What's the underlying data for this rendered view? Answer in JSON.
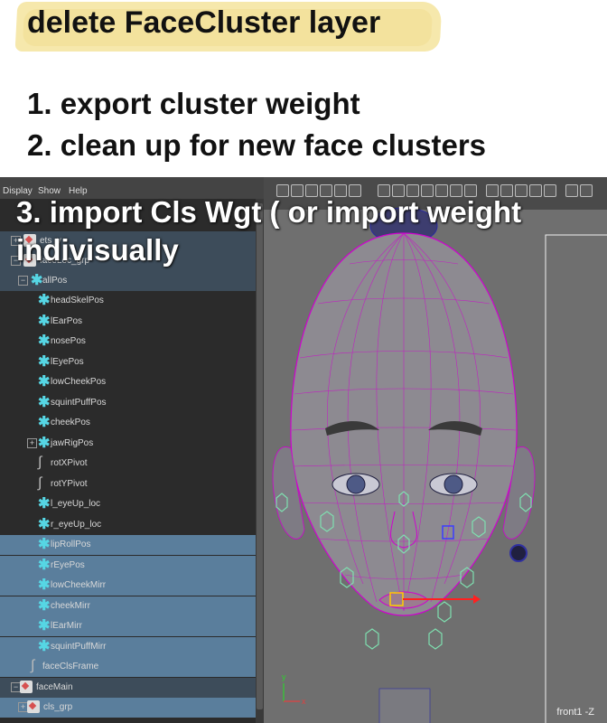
{
  "instructions": {
    "title": "delete FaceCluster layer",
    "step1": "1. export cluster weight",
    "step2": "2. clean up for new face clusters",
    "step3_line1": "3. import Cls Wgt ( or import weight",
    "step3_line2": "indivisually"
  },
  "menubar": {
    "display": "Display",
    "show": "Show",
    "help": "Help"
  },
  "outliner": {
    "rows": [
      {
        "label": "ets_v",
        "icon": "node-icon"
      },
      {
        "label": "faceLoc_grp",
        "icon": "node-icon"
      },
      {
        "label": "allPos",
        "icon": "locator-icon"
      },
      {
        "label": "headSkelPos",
        "icon": "locator-icon"
      },
      {
        "label": "lEarPos",
        "icon": "locator-icon"
      },
      {
        "label": "nosePos",
        "icon": "locator-icon"
      },
      {
        "label": "lEyePos",
        "icon": "locator-icon"
      },
      {
        "label": "lowCheekPos",
        "icon": "locator-icon"
      },
      {
        "label": "squintPuffPos",
        "icon": "locator-icon"
      },
      {
        "label": "cheekPos",
        "icon": "locator-icon"
      },
      {
        "label": "jawRigPos",
        "icon": "locator-icon"
      },
      {
        "label": "rotXPivot",
        "icon": "curve-icon"
      },
      {
        "label": "rotYPivot",
        "icon": "curve-icon"
      },
      {
        "label": "l_eyeUp_loc",
        "icon": "locator-icon"
      },
      {
        "label": "r_eyeUp_loc",
        "icon": "locator-icon"
      },
      {
        "label": "lipRollPos",
        "icon": "locator-icon"
      },
      {
        "label": "rEyePos",
        "icon": "locator-icon"
      },
      {
        "label": "lowCheekMirr",
        "icon": "locator-icon"
      },
      {
        "label": "cheekMirr",
        "icon": "locator-icon"
      },
      {
        "label": "lEarMirr",
        "icon": "locator-icon"
      },
      {
        "label": "squintPuffMirr",
        "icon": "locator-icon"
      },
      {
        "label": "faceClsFrame",
        "icon": "curve-icon"
      },
      {
        "label": "faceMain",
        "icon": "node-icon"
      },
      {
        "label": "cls_grp",
        "icon": "node-icon"
      }
    ]
  },
  "viewport": {
    "camera_label": "front1 -Z"
  },
  "colors": {
    "selection": "#5a7e9c",
    "wireframe": "#e000e0",
    "locator": "#56d6e4",
    "control": "#7fe0b0"
  }
}
